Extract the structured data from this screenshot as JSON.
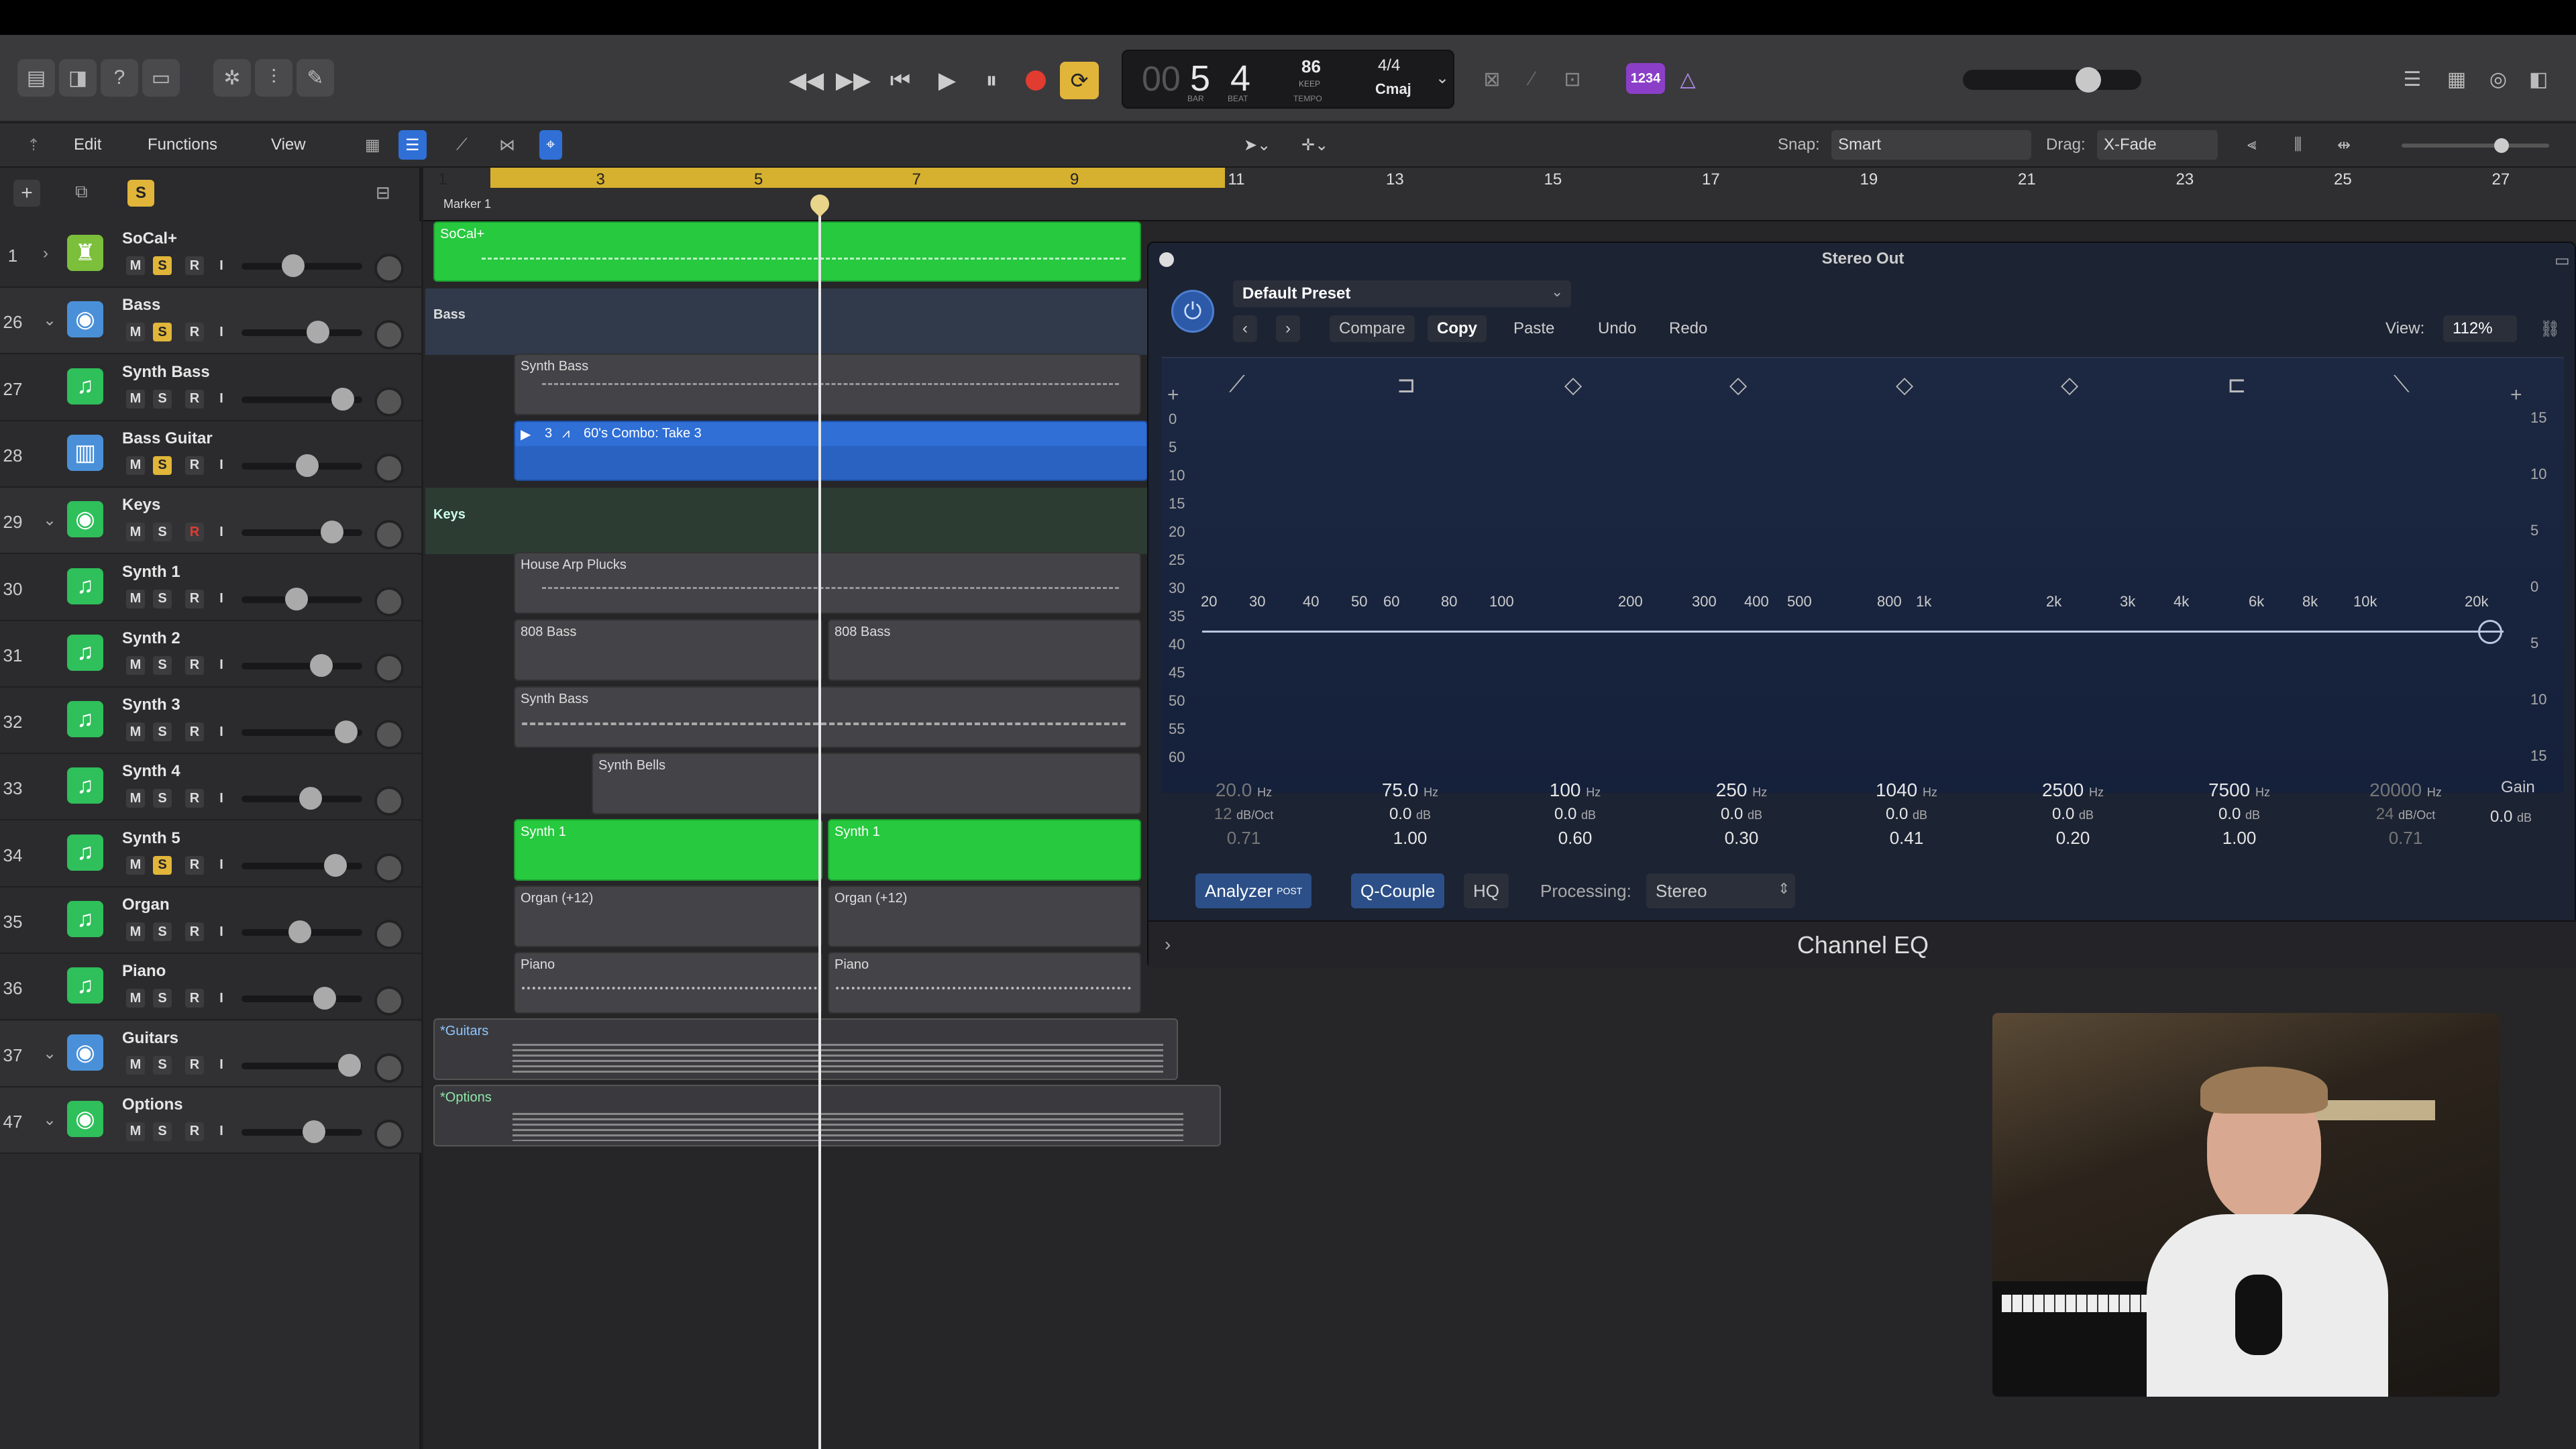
{
  "toolbar": {
    "menus": [
      "Edit",
      "Functions",
      "View"
    ],
    "snap_label": "Snap:",
    "snap_value": "Smart",
    "drag_label": "Drag:",
    "drag_value": "X-Fade",
    "s_badge": "S"
  },
  "lcd": {
    "bar": "5",
    "beat": "4",
    "bar_caption": "BAR",
    "beat_caption": "BEAT",
    "tempo": "86",
    "tempo_sub": "KEEP",
    "tempo_caption": "TEMPO",
    "signature": "4/4",
    "key": "Cmaj",
    "prefix": "00"
  },
  "count_in": "1234",
  "ruler": {
    "marks": [
      "1",
      "3",
      "5",
      "7",
      "9",
      "11",
      "13",
      "15",
      "17",
      "19",
      "21",
      "23",
      "25",
      "27"
    ],
    "marker": "Marker 1"
  },
  "tracks": [
    {
      "num": "1",
      "name": "SoCal+",
      "color": "#7bbf3a",
      "icon": "drum-kit-icon",
      "solo": true,
      "rec": false
    },
    {
      "num": "26",
      "name": "Bass",
      "color": "#4a90d9",
      "icon": "folder-stack-icon",
      "solo": true,
      "rec": false
    },
    {
      "num": "27",
      "name": "Synth Bass",
      "color": "#2fbf5b",
      "icon": "synth-icon",
      "solo": false,
      "rec": false
    },
    {
      "num": "28",
      "name": "Bass Guitar",
      "color": "#4a90d9",
      "icon": "amp-icon",
      "solo": true,
      "rec": false
    },
    {
      "num": "29",
      "name": "Keys",
      "color": "#2fbf5b",
      "icon": "folder-stack-icon",
      "solo": false,
      "rec": true
    },
    {
      "num": "30",
      "name": "Synth 1",
      "color": "#2fbf5b",
      "icon": "synth-icon",
      "solo": false,
      "rec": false
    },
    {
      "num": "31",
      "name": "Synth 2",
      "color": "#2fbf5b",
      "icon": "synth-icon",
      "solo": false,
      "rec": false
    },
    {
      "num": "32",
      "name": "Synth 3",
      "color": "#2fbf5b",
      "icon": "synth-icon",
      "solo": false,
      "rec": false
    },
    {
      "num": "33",
      "name": "Synth 4",
      "color": "#2fbf5b",
      "icon": "synth-icon",
      "solo": false,
      "rec": false
    },
    {
      "num": "34",
      "name": "Synth 5",
      "color": "#2fbf5b",
      "icon": "synth-icon",
      "solo": true,
      "rec": false
    },
    {
      "num": "35",
      "name": "Organ",
      "color": "#2fbf5b",
      "icon": "synth-icon",
      "solo": false,
      "rec": false
    },
    {
      "num": "36",
      "name": "Piano",
      "color": "#2fbf5b",
      "icon": "synth-icon",
      "solo": false,
      "rec": false
    },
    {
      "num": "37",
      "name": "Guitars",
      "color": "#4a90d9",
      "icon": "folder-stack-icon",
      "solo": false,
      "rec": false
    },
    {
      "num": "47",
      "name": "Options",
      "color": "#2fbf5b",
      "icon": "folder-stack-icon",
      "solo": false,
      "rec": false
    }
  ],
  "track_buttons": {
    "mute": "M",
    "solo": "S",
    "record": "R",
    "input": "I"
  },
  "regions": {
    "socal": "SoCal+",
    "bass_folder": "Bass",
    "synth_bass": "Synth Bass",
    "bass_take_num": "3",
    "bass_take": "60's Combo: Take 3",
    "keys_folder": "Keys",
    "house_arp": "House Arp Plucks",
    "bass808_a": "808 Bass",
    "bass808_b": "808 Bass",
    "synth_bass2": "Synth Bass",
    "synth_bells": "Synth Bells",
    "synth1_a": "Synth 1",
    "synth1_b": "Synth 1",
    "organ_a": "Organ (+12)",
    "organ_b": "Organ (+12)",
    "piano_a": "Piano",
    "piano_b": "Piano",
    "guitars": "*Guitars",
    "options": "*Options"
  },
  "eq": {
    "title": "Stereo Out",
    "preset": "Default Preset",
    "compare": "Compare",
    "copy": "Copy",
    "paste": "Paste",
    "undo": "Undo",
    "redo": "Redo",
    "view_label": "View:",
    "view_value": "112%",
    "db_scale": [
      "0",
      "5",
      "10",
      "15",
      "20",
      "25",
      "30",
      "35",
      "40",
      "45",
      "50",
      "55",
      "60"
    ],
    "gain_scale": [
      "15",
      "10",
      "5",
      "0",
      "5",
      "10",
      "15"
    ],
    "freq_scale": [
      "20",
      "30",
      "40",
      "50",
      "60",
      "80",
      "100",
      "200",
      "300",
      "400",
      "500",
      "800",
      "1k",
      "2k",
      "3k",
      "4k",
      "6k",
      "8k",
      "10k",
      "20k"
    ],
    "bands": [
      {
        "freq": "20.0",
        "unit": "Hz",
        "gain": "12",
        "gain_unit": "dB/Oct",
        "q": "0.71",
        "dim": true
      },
      {
        "freq": "75.0",
        "unit": "Hz",
        "gain": "0.0",
        "gain_unit": "dB",
        "q": "1.00",
        "dim": false
      },
      {
        "freq": "100",
        "unit": "Hz",
        "gain": "0.0",
        "gain_unit": "dB",
        "q": "0.60",
        "dim": false
      },
      {
        "freq": "250",
        "unit": "Hz",
        "gain": "0.0",
        "gain_unit": "dB",
        "q": "0.30",
        "dim": false
      },
      {
        "freq": "1040",
        "unit": "Hz",
        "gain": "0.0",
        "gain_unit": "dB",
        "q": "0.41",
        "dim": false
      },
      {
        "freq": "2500",
        "unit": "Hz",
        "gain": "0.0",
        "gain_unit": "dB",
        "q": "0.20",
        "dim": false
      },
      {
        "freq": "7500",
        "unit": "Hz",
        "gain": "0.0",
        "gain_unit": "dB",
        "q": "1.00",
        "dim": false
      },
      {
        "freq": "20000",
        "unit": "Hz",
        "gain": "24",
        "gain_unit": "dB/Oct",
        "q": "0.71",
        "dim": true
      }
    ],
    "gain_label": "Gain",
    "gain_value": "0.0",
    "gain_unit": "dB",
    "analyzer": "Analyzer",
    "analyzer_sup": "POST",
    "q_couple": "Q-Couple",
    "hq": "HQ",
    "processing_label": "Processing:",
    "processing_value": "Stereo",
    "plugin_name": "Channel EQ"
  },
  "colors": {
    "region_green": "#27c93f",
    "region_blue": "#2f6fd6",
    "ruler_yellow": "#d6b02f",
    "record_red": "#e23b30",
    "cycle_yellow": "#e0b53a",
    "count_purple": "#8b3fc8"
  }
}
